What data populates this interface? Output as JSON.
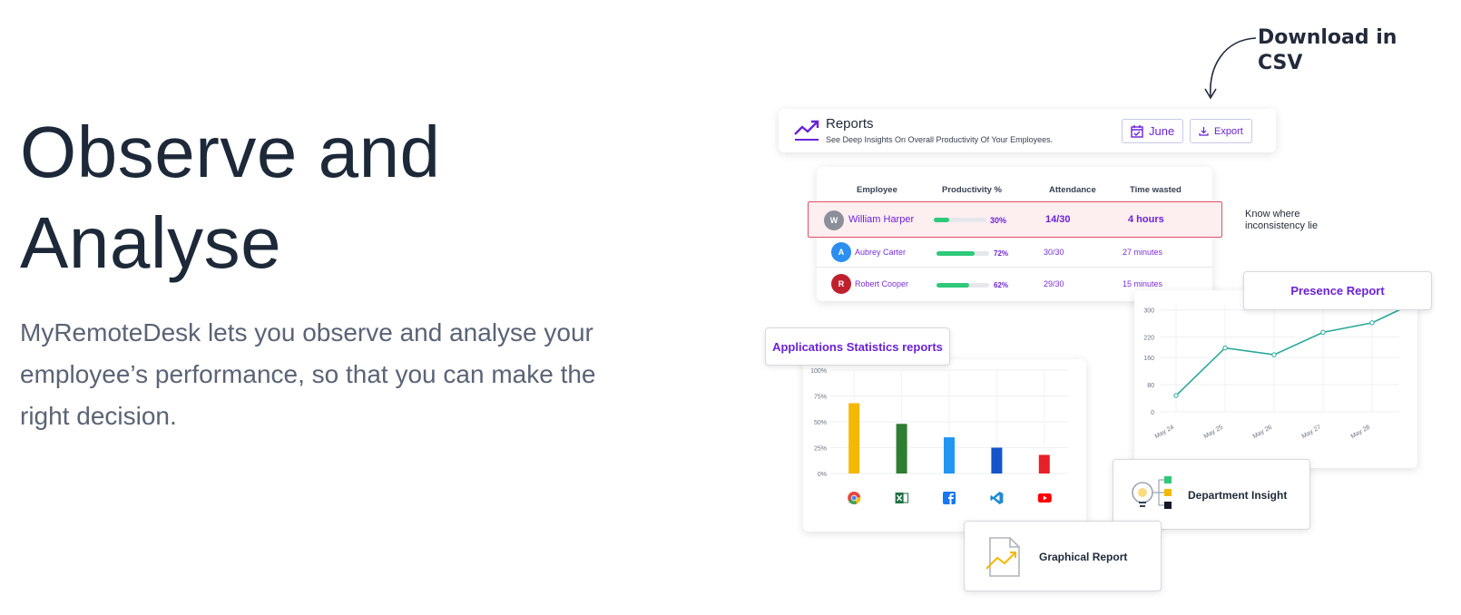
{
  "hero": {
    "title_line1": "Observe and",
    "title_line2": "Analyse",
    "description": "MyRemoteDesk lets you observe and analyse your employee’s performance, so that you can make the right decision."
  },
  "callout": {
    "download": "Download in CSV"
  },
  "reports": {
    "title": "Reports",
    "subtitle": "See Deep Insights On Overall Productivity Of Your Employees.",
    "month_button": "June",
    "export_button": "Export"
  },
  "table": {
    "headers": [
      "Employee",
      "Productivity %",
      "Attendance",
      "Time wasted"
    ],
    "rows": [
      {
        "initial": "W",
        "name": "William Harper",
        "productivity": 0.3,
        "productivity_label": "30%",
        "attendance": "14/30",
        "time_wasted": "4 hours",
        "avatar_color": "#8b8f9a"
      },
      {
        "initial": "A",
        "name": "Aubrey Carter",
        "productivity": 0.72,
        "productivity_label": "72%",
        "attendance": "30/30",
        "time_wasted": "27 minutes",
        "avatar_color": "#2b8ef0"
      },
      {
        "initial": "R",
        "name": "Robert Cooper",
        "productivity": 0.62,
        "productivity_label": "62%",
        "attendance": "29/30",
        "time_wasted": "15 minutes",
        "avatar_color": "#c0202e"
      }
    ]
  },
  "annotation": {
    "inconsistency": "Know where inconsistency lie"
  },
  "apps_stats": {
    "label": "Applications Statistics reports"
  },
  "presence": {
    "label": "Presence Report"
  },
  "dept": {
    "label": "Department Insight"
  },
  "graphical": {
    "label": "Graphical Report"
  },
  "chart_data": [
    {
      "type": "bar",
      "categories": [
        "chrome-icon",
        "excel-icon",
        "facebook-icon",
        "vscode-icon",
        "youtube-icon"
      ],
      "values": [
        68,
        48,
        35,
        25,
        18
      ],
      "colors": [
        "#f5b800",
        "#2e7d32",
        "#2196f3",
        "#1554c9",
        "#e8202a"
      ],
      "yticks": [
        "0%",
        "25%",
        "50%",
        "75%",
        "100%"
      ],
      "ylim": [
        0,
        100
      ],
      "grid": true
    },
    {
      "type": "line",
      "x": [
        "May 24",
        "May 25",
        "May 26",
        "May 27",
        "May 28"
      ],
      "values": [
        48,
        188,
        168,
        234,
        262,
        330
      ],
      "yticks": [
        "0",
        "80",
        "160",
        "220",
        "300"
      ],
      "ylim": [
        0,
        315
      ],
      "color": "#2aa89a",
      "grid": true
    }
  ]
}
